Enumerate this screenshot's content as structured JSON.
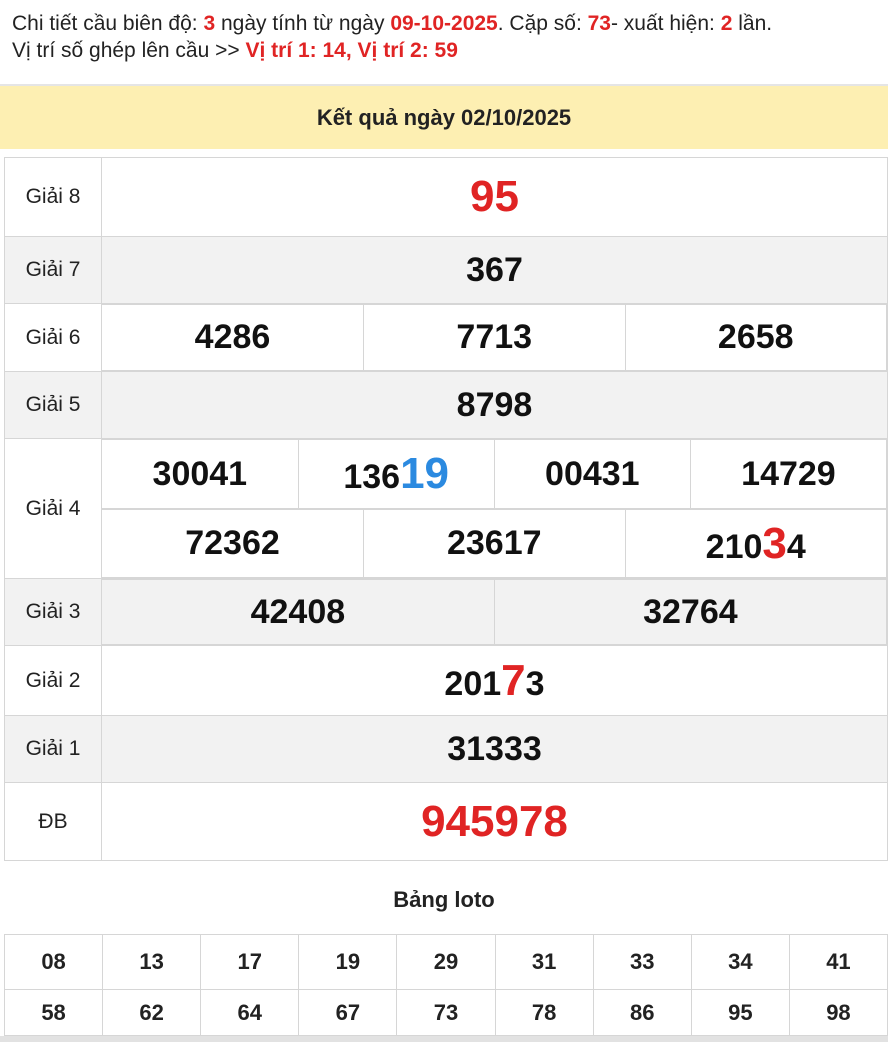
{
  "info": {
    "line1_prefix": "Chi tiết cầu biên độ: ",
    "bien_do": "3",
    "line1_mid": " ngày tính từ ngày ",
    "from_date": "09-10-2025",
    "line1_mid2": ". Cặp số: ",
    "cap_so": "73",
    "line1_mid3": "- xuất hiện: ",
    "count": "2",
    "line1_end": " lần.",
    "line2_prefix": "Vị trí số ghép lên cầu >> ",
    "positions": "Vị trí 1: 14, Vị trí 2: 59"
  },
  "result": {
    "header": "Kết quả ngày 02/10/2025",
    "g8": {
      "label": "Giải 8",
      "value": "95"
    },
    "g7": {
      "label": "Giải 7",
      "value": "367"
    },
    "g6": {
      "label": "Giải 6",
      "values": [
        "4286",
        "7713",
        "2658"
      ]
    },
    "g5": {
      "label": "Giải 5",
      "value": "8798"
    },
    "g4": {
      "label": "Giải 4",
      "row1": [
        "30041",
        "13619",
        "00431",
        "14729"
      ],
      "row2": [
        "72362",
        "23617",
        "21034"
      ],
      "row1_2_prefix": "136",
      "row1_2_highlight": "19",
      "row2_3_prefix": "210",
      "row2_3_highlight": "3",
      "row2_3_suffix": "4"
    },
    "g3": {
      "label": "Giải 3",
      "values": [
        "42408",
        "32764"
      ]
    },
    "g2": {
      "label": "Giải 2",
      "value": "20173",
      "prefix": "201",
      "highlight": "7",
      "suffix": "3"
    },
    "g1": {
      "label": "Giải 1",
      "value": "31333"
    },
    "db": {
      "label": "ĐB",
      "value": "945978"
    }
  },
  "loto": {
    "title": "Bảng loto",
    "row1": [
      "08",
      "13",
      "17",
      "19",
      "29",
      "31",
      "33",
      "34",
      "41"
    ],
    "row2": [
      "58",
      "62",
      "64",
      "67",
      "73",
      "78",
      "86",
      "95",
      "98"
    ]
  },
  "colors": {
    "highlight_red": "#e02424",
    "highlight_blue": "#2b8ae0",
    "header_bg": "#fdefb2",
    "row_grey": "#f2f2f2"
  }
}
